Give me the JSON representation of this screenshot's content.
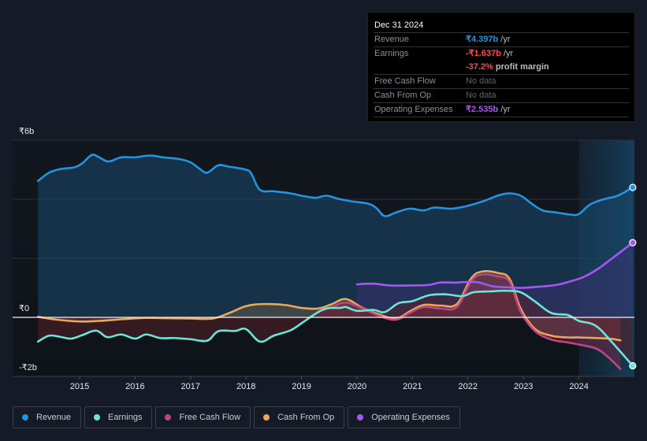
{
  "tooltip": {
    "date": "Dec 31 2024",
    "rows": [
      {
        "label": "Revenue",
        "value": "₹4.397b",
        "unit": " /yr",
        "color": "#2394df"
      },
      {
        "label": "Earnings",
        "value": "-₹1.637b",
        "unit": " /yr",
        "color": "#ff4a4a",
        "extra_value": "-37.2%",
        "extra_text": " profit margin"
      },
      {
        "label": "Free Cash Flow",
        "value": "No data"
      },
      {
        "label": "Cash From Op",
        "value": "No data"
      },
      {
        "label": "Operating Expenses",
        "value": "₹2.535b",
        "unit": " /yr",
        "color": "#a855f7"
      }
    ]
  },
  "legend": [
    {
      "label": "Revenue",
      "color": "#2394df"
    },
    {
      "label": "Earnings",
      "color": "#6ce5d8"
    },
    {
      "label": "Free Cash Flow",
      "color": "#c1457e"
    },
    {
      "label": "Cash From Op",
      "color": "#e9a95a"
    },
    {
      "label": "Operating Expenses",
      "color": "#a855f7"
    }
  ],
  "chart_data": {
    "type": "area",
    "title": "",
    "xlabel": "",
    "ylabel": "",
    "currency": "₹",
    "ylim": [
      -2,
      6
    ],
    "xlim": [
      2013.7,
      2024.97
    ],
    "yticks": [
      {
        "value": 6,
        "label": "₹6b"
      },
      {
        "value": 0,
        "label": "₹0"
      },
      {
        "value": -2,
        "label": "-₹2b"
      }
    ],
    "gridlines": [
      6,
      4,
      2,
      0,
      -2
    ],
    "xticks": [
      {
        "value": 2015,
        "label": "2015"
      },
      {
        "value": 2016,
        "label": "2016"
      },
      {
        "value": 2017,
        "label": "2017"
      },
      {
        "value": 2018,
        "label": "2018"
      },
      {
        "value": 2019,
        "label": "2019"
      },
      {
        "value": 2020,
        "label": "2020"
      },
      {
        "value": 2021,
        "label": "2021"
      },
      {
        "value": 2022,
        "label": "2022"
      },
      {
        "value": 2023,
        "label": "2023"
      },
      {
        "value": 2024,
        "label": "2024"
      }
    ],
    "highlight_from": 2024.0,
    "series": [
      {
        "name": "Revenue",
        "color": "#2394df",
        "fill": "#1a4a70",
        "points": [
          [
            2014.25,
            4.62
          ],
          [
            2014.45,
            4.9
          ],
          [
            2014.65,
            5.02
          ],
          [
            2014.9,
            5.08
          ],
          [
            2015.05,
            5.22
          ],
          [
            2015.22,
            5.5
          ],
          [
            2015.35,
            5.42
          ],
          [
            2015.52,
            5.28
          ],
          [
            2015.75,
            5.42
          ],
          [
            2016.0,
            5.42
          ],
          [
            2016.27,
            5.48
          ],
          [
            2016.5,
            5.42
          ],
          [
            2016.8,
            5.36
          ],
          [
            2017.0,
            5.25
          ],
          [
            2017.15,
            5.05
          ],
          [
            2017.3,
            4.9
          ],
          [
            2017.5,
            5.15
          ],
          [
            2017.7,
            5.1
          ],
          [
            2018.0,
            5.0
          ],
          [
            2018.1,
            4.85
          ],
          [
            2018.25,
            4.32
          ],
          [
            2018.5,
            4.27
          ],
          [
            2018.8,
            4.2
          ],
          [
            2019.0,
            4.12
          ],
          [
            2019.25,
            4.05
          ],
          [
            2019.45,
            4.12
          ],
          [
            2019.65,
            4.02
          ],
          [
            2019.9,
            3.93
          ],
          [
            2020.2,
            3.85
          ],
          [
            2020.35,
            3.7
          ],
          [
            2020.5,
            3.43
          ],
          [
            2020.7,
            3.55
          ],
          [
            2020.95,
            3.68
          ],
          [
            2021.2,
            3.62
          ],
          [
            2021.4,
            3.72
          ],
          [
            2021.7,
            3.68
          ],
          [
            2022.0,
            3.78
          ],
          [
            2022.3,
            3.95
          ],
          [
            2022.55,
            4.13
          ],
          [
            2022.75,
            4.2
          ],
          [
            2022.95,
            4.12
          ],
          [
            2023.15,
            3.85
          ],
          [
            2023.35,
            3.62
          ],
          [
            2023.6,
            3.55
          ],
          [
            2023.85,
            3.48
          ],
          [
            2024.0,
            3.5
          ],
          [
            2024.2,
            3.82
          ],
          [
            2024.45,
            4.0
          ],
          [
            2024.7,
            4.12
          ],
          [
            2024.97,
            4.4
          ]
        ]
      },
      {
        "name": "Earnings",
        "color": "#6ce5d8",
        "fill": "#5a1f27",
        "points": [
          [
            2014.25,
            -0.82
          ],
          [
            2014.45,
            -0.62
          ],
          [
            2014.65,
            -0.66
          ],
          [
            2014.85,
            -0.72
          ],
          [
            2015.05,
            -0.6
          ],
          [
            2015.3,
            -0.45
          ],
          [
            2015.5,
            -0.67
          ],
          [
            2015.75,
            -0.58
          ],
          [
            2016.0,
            -0.72
          ],
          [
            2016.2,
            -0.58
          ],
          [
            2016.45,
            -0.7
          ],
          [
            2016.7,
            -0.7
          ],
          [
            2017.0,
            -0.74
          ],
          [
            2017.3,
            -0.79
          ],
          [
            2017.5,
            -0.47
          ],
          [
            2017.8,
            -0.46
          ],
          [
            2018.0,
            -0.4
          ],
          [
            2018.25,
            -0.82
          ],
          [
            2018.5,
            -0.62
          ],
          [
            2018.8,
            -0.44
          ],
          [
            2019.0,
            -0.2
          ],
          [
            2019.25,
            0.12
          ],
          [
            2019.45,
            0.3
          ],
          [
            2019.7,
            0.32
          ],
          [
            2019.8,
            0.35
          ],
          [
            2020.0,
            0.22
          ],
          [
            2020.3,
            0.25
          ],
          [
            2020.5,
            0.18
          ],
          [
            2020.75,
            0.48
          ],
          [
            2021.0,
            0.55
          ],
          [
            2021.3,
            0.75
          ],
          [
            2021.6,
            0.78
          ],
          [
            2021.9,
            0.72
          ],
          [
            2022.1,
            0.85
          ],
          [
            2022.4,
            0.88
          ],
          [
            2022.7,
            0.9
          ],
          [
            2022.95,
            0.85
          ],
          [
            2023.2,
            0.55
          ],
          [
            2023.5,
            0.15
          ],
          [
            2023.8,
            0.08
          ],
          [
            2024.0,
            -0.12
          ],
          [
            2024.3,
            -0.28
          ],
          [
            2024.6,
            -0.85
          ],
          [
            2024.97,
            -1.64
          ]
        ]
      },
      {
        "name": "Free Cash Flow",
        "color": "#c1457e",
        "fill": "#7a2a50",
        "points": [
          [
            2019.3,
            0.2
          ],
          [
            2019.55,
            0.35
          ],
          [
            2019.8,
            0.5
          ],
          [
            2020.1,
            0.3
          ],
          [
            2020.4,
            0.05
          ],
          [
            2020.7,
            -0.08
          ],
          [
            2020.95,
            0.15
          ],
          [
            2021.2,
            0.35
          ],
          [
            2021.5,
            0.3
          ],
          [
            2021.8,
            0.35
          ],
          [
            2022.05,
            1.2
          ],
          [
            2022.25,
            1.45
          ],
          [
            2022.55,
            1.38
          ],
          [
            2022.75,
            1.2
          ],
          [
            2022.95,
            0.2
          ],
          [
            2023.2,
            -0.45
          ],
          [
            2023.5,
            -0.75
          ],
          [
            2023.8,
            -0.85
          ],
          [
            2024.0,
            -0.92
          ],
          [
            2024.3,
            -1.05
          ],
          [
            2024.5,
            -1.3
          ],
          [
            2024.75,
            -1.75
          ]
        ]
      },
      {
        "name": "Cash From Op",
        "color": "#e9a95a",
        "fill": "#6a5a48",
        "points": [
          [
            2014.25,
            0.02
          ],
          [
            2014.6,
            -0.08
          ],
          [
            2015.0,
            -0.14
          ],
          [
            2015.35,
            -0.12
          ],
          [
            2015.8,
            -0.06
          ],
          [
            2016.2,
            -0.02
          ],
          [
            2016.6,
            -0.03
          ],
          [
            2017.0,
            -0.04
          ],
          [
            2017.4,
            -0.04
          ],
          [
            2017.7,
            0.15
          ],
          [
            2018.0,
            0.38
          ],
          [
            2018.3,
            0.45
          ],
          [
            2018.7,
            0.42
          ],
          [
            2019.0,
            0.32
          ],
          [
            2019.3,
            0.3
          ],
          [
            2019.55,
            0.45
          ],
          [
            2019.8,
            0.62
          ],
          [
            2020.1,
            0.32
          ],
          [
            2020.4,
            0.1
          ],
          [
            2020.7,
            -0.04
          ],
          [
            2020.95,
            0.2
          ],
          [
            2021.2,
            0.42
          ],
          [
            2021.5,
            0.4
          ],
          [
            2021.8,
            0.45
          ],
          [
            2022.05,
            1.3
          ],
          [
            2022.25,
            1.55
          ],
          [
            2022.55,
            1.5
          ],
          [
            2022.75,
            1.3
          ],
          [
            2022.95,
            0.3
          ],
          [
            2023.2,
            -0.38
          ],
          [
            2023.5,
            -0.62
          ],
          [
            2023.8,
            -0.68
          ],
          [
            2024.0,
            -0.68
          ],
          [
            2024.3,
            -0.7
          ],
          [
            2024.55,
            -0.72
          ],
          [
            2024.75,
            -0.78
          ]
        ]
      },
      {
        "name": "Operating Expenses",
        "color": "#a855f7",
        "fill": "#3b2f70",
        "points": [
          [
            2020.0,
            1.12
          ],
          [
            2020.3,
            1.14
          ],
          [
            2020.6,
            1.08
          ],
          [
            2021.0,
            1.08
          ],
          [
            2021.3,
            1.1
          ],
          [
            2021.5,
            1.18
          ],
          [
            2021.8,
            1.18
          ],
          [
            2022.0,
            1.2
          ],
          [
            2022.2,
            1.18
          ],
          [
            2022.45,
            1.05
          ],
          [
            2022.7,
            1.02
          ],
          [
            2023.0,
            1.0
          ],
          [
            2023.35,
            1.05
          ],
          [
            2023.6,
            1.1
          ],
          [
            2023.85,
            1.22
          ],
          [
            2024.1,
            1.38
          ],
          [
            2024.35,
            1.65
          ],
          [
            2024.6,
            2.0
          ],
          [
            2024.97,
            2.53
          ]
        ]
      }
    ],
    "end_markers": [
      {
        "series": "Revenue",
        "x": 2024.97,
        "y": 4.4
      },
      {
        "series": "Operating Expenses",
        "x": 2024.97,
        "y": 2.53
      },
      {
        "series": "Earnings",
        "x": 2024.97,
        "y": -1.64
      }
    ]
  }
}
